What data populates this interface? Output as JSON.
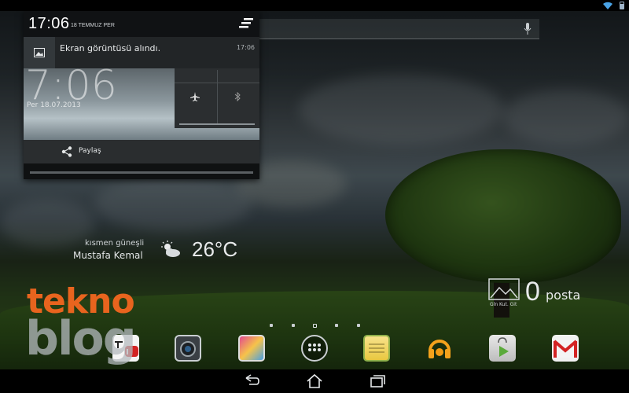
{
  "notification_panel": {
    "time": "17:06",
    "date": "18 TEMMUZ PER",
    "notification": {
      "text": "Ekran görüntüsü alındı.",
      "time": "17:06"
    },
    "share_label": "Paylaş",
    "preview": {
      "clock": "7:06",
      "date": "Per 18.07.2013"
    }
  },
  "home": {
    "weather": {
      "description": "kısmen güneşli",
      "location": "Mustafa Kemal",
      "temperature": "26°C",
      "icon": "partly-sunny-icon"
    },
    "mail_widget": {
      "label": "Gln Kut. Git",
      "count": "0",
      "unit": "posta"
    }
  },
  "watermark": {
    "line1": "tekno",
    "line2": "blog"
  },
  "colors": {
    "watermark_orange": "#e8641e",
    "panel_bg": "#0f1112"
  }
}
